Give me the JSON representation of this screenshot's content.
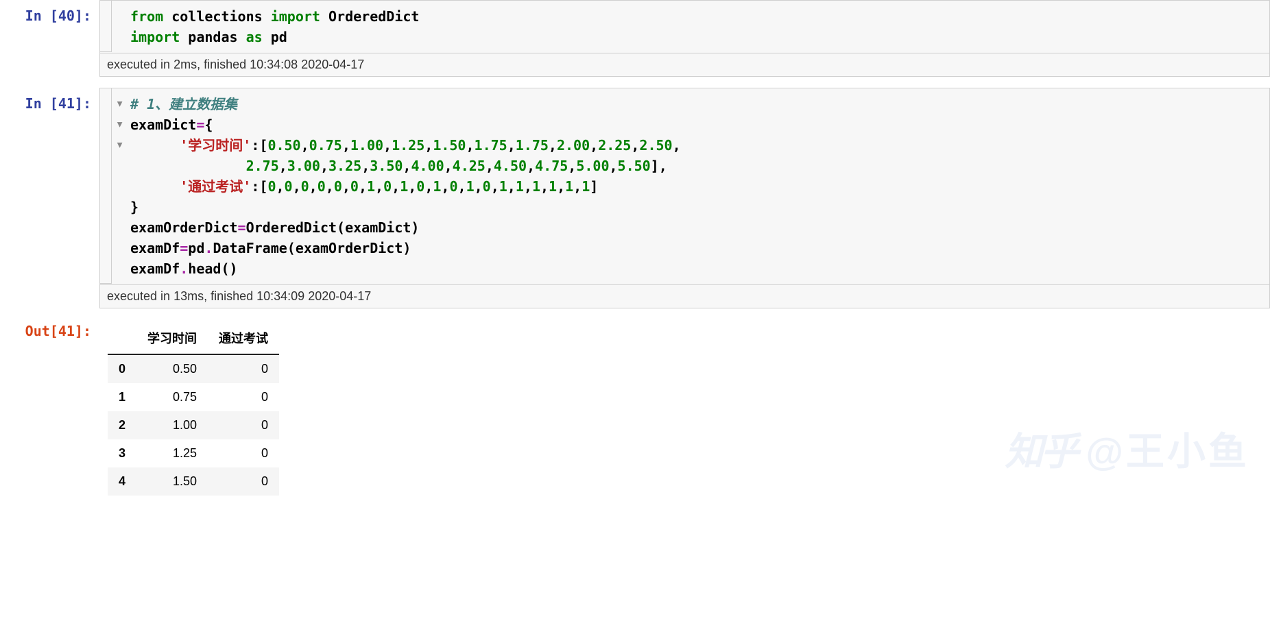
{
  "cells": {
    "cell40": {
      "prompt": "In [40]:",
      "exec_status": "executed in 2ms, finished 10:34:08 2020-04-17",
      "code_tokens": [
        [
          {
            "t": "from",
            "c": "kw"
          },
          {
            "t": " ",
            "c": "plain"
          },
          {
            "t": "collections",
            "c": "plain"
          },
          {
            "t": " ",
            "c": "plain"
          },
          {
            "t": "import",
            "c": "kw"
          },
          {
            "t": " ",
            "c": "plain"
          },
          {
            "t": "OrderedDict",
            "c": "plain"
          }
        ],
        [
          {
            "t": "import",
            "c": "kw"
          },
          {
            "t": " ",
            "c": "plain"
          },
          {
            "t": "pandas",
            "c": "plain"
          },
          {
            "t": " ",
            "c": "plain"
          },
          {
            "t": "as",
            "c": "kw"
          },
          {
            "t": " ",
            "c": "plain"
          },
          {
            "t": "pd",
            "c": "plain"
          }
        ]
      ]
    },
    "cell41": {
      "prompt": "In [41]:",
      "exec_status": "executed in 13ms, finished 10:34:09 2020-04-17",
      "gutter_markers": [
        "▶",
        "▶",
        "▶"
      ],
      "code_tokens": [
        [
          {
            "t": "# 1、建立数据集",
            "c": "cmt"
          }
        ],
        [
          {
            "t": "examDict",
            "c": "plain"
          },
          {
            "t": "=",
            "c": "op"
          },
          {
            "t": "{",
            "c": "plain"
          }
        ],
        [
          {
            "t": "      ",
            "c": "plain"
          },
          {
            "t": "'学习时间'",
            "c": "str"
          },
          {
            "t": ":[",
            "c": "plain"
          },
          {
            "t": "0.50",
            "c": "num"
          },
          {
            "t": ",",
            "c": "plain"
          },
          {
            "t": "0.75",
            "c": "num"
          },
          {
            "t": ",",
            "c": "plain"
          },
          {
            "t": "1.00",
            "c": "num"
          },
          {
            "t": ",",
            "c": "plain"
          },
          {
            "t": "1.25",
            "c": "num"
          },
          {
            "t": ",",
            "c": "plain"
          },
          {
            "t": "1.50",
            "c": "num"
          },
          {
            "t": ",",
            "c": "plain"
          },
          {
            "t": "1.75",
            "c": "num"
          },
          {
            "t": ",",
            "c": "plain"
          },
          {
            "t": "1.75",
            "c": "num"
          },
          {
            "t": ",",
            "c": "plain"
          },
          {
            "t": "2.00",
            "c": "num"
          },
          {
            "t": ",",
            "c": "plain"
          },
          {
            "t": "2.25",
            "c": "num"
          },
          {
            "t": ",",
            "c": "plain"
          },
          {
            "t": "2.50",
            "c": "num"
          },
          {
            "t": ",",
            "c": "plain"
          }
        ],
        [
          {
            "t": "              ",
            "c": "plain"
          },
          {
            "t": "2.75",
            "c": "num"
          },
          {
            "t": ",",
            "c": "plain"
          },
          {
            "t": "3.00",
            "c": "num"
          },
          {
            "t": ",",
            "c": "plain"
          },
          {
            "t": "3.25",
            "c": "num"
          },
          {
            "t": ",",
            "c": "plain"
          },
          {
            "t": "3.50",
            "c": "num"
          },
          {
            "t": ",",
            "c": "plain"
          },
          {
            "t": "4.00",
            "c": "num"
          },
          {
            "t": ",",
            "c": "plain"
          },
          {
            "t": "4.25",
            "c": "num"
          },
          {
            "t": ",",
            "c": "plain"
          },
          {
            "t": "4.50",
            "c": "num"
          },
          {
            "t": ",",
            "c": "plain"
          },
          {
            "t": "4.75",
            "c": "num"
          },
          {
            "t": ",",
            "c": "plain"
          },
          {
            "t": "5.00",
            "c": "num"
          },
          {
            "t": ",",
            "c": "plain"
          },
          {
            "t": "5.50",
            "c": "num"
          },
          {
            "t": "],",
            "c": "plain"
          }
        ],
        [
          {
            "t": "      ",
            "c": "plain"
          },
          {
            "t": "'通过考试'",
            "c": "str"
          },
          {
            "t": ":[",
            "c": "plain"
          },
          {
            "t": "0",
            "c": "num"
          },
          {
            "t": ",",
            "c": "plain"
          },
          {
            "t": "0",
            "c": "num"
          },
          {
            "t": ",",
            "c": "plain"
          },
          {
            "t": "0",
            "c": "num"
          },
          {
            "t": ",",
            "c": "plain"
          },
          {
            "t": "0",
            "c": "num"
          },
          {
            "t": ",",
            "c": "plain"
          },
          {
            "t": "0",
            "c": "num"
          },
          {
            "t": ",",
            "c": "plain"
          },
          {
            "t": "0",
            "c": "num"
          },
          {
            "t": ",",
            "c": "plain"
          },
          {
            "t": "1",
            "c": "num"
          },
          {
            "t": ",",
            "c": "plain"
          },
          {
            "t": "0",
            "c": "num"
          },
          {
            "t": ",",
            "c": "plain"
          },
          {
            "t": "1",
            "c": "num"
          },
          {
            "t": ",",
            "c": "plain"
          },
          {
            "t": "0",
            "c": "num"
          },
          {
            "t": ",",
            "c": "plain"
          },
          {
            "t": "1",
            "c": "num"
          },
          {
            "t": ",",
            "c": "plain"
          },
          {
            "t": "0",
            "c": "num"
          },
          {
            "t": ",",
            "c": "plain"
          },
          {
            "t": "1",
            "c": "num"
          },
          {
            "t": ",",
            "c": "plain"
          },
          {
            "t": "0",
            "c": "num"
          },
          {
            "t": ",",
            "c": "plain"
          },
          {
            "t": "1",
            "c": "num"
          },
          {
            "t": ",",
            "c": "plain"
          },
          {
            "t": "1",
            "c": "num"
          },
          {
            "t": ",",
            "c": "plain"
          },
          {
            "t": "1",
            "c": "num"
          },
          {
            "t": ",",
            "c": "plain"
          },
          {
            "t": "1",
            "c": "num"
          },
          {
            "t": ",",
            "c": "plain"
          },
          {
            "t": "1",
            "c": "num"
          },
          {
            "t": ",",
            "c": "plain"
          },
          {
            "t": "1",
            "c": "num"
          },
          {
            "t": "]",
            "c": "plain"
          }
        ],
        [
          {
            "t": "}",
            "c": "plain"
          }
        ],
        [
          {
            "t": "examOrderDict",
            "c": "plain"
          },
          {
            "t": "=",
            "c": "op"
          },
          {
            "t": "OrderedDict(examDict)",
            "c": "plain"
          }
        ],
        [
          {
            "t": "examDf",
            "c": "plain"
          },
          {
            "t": "=",
            "c": "op"
          },
          {
            "t": "pd",
            "c": "plain"
          },
          {
            "t": ".",
            "c": "op"
          },
          {
            "t": "DataFrame(examOrderDict)",
            "c": "plain"
          }
        ],
        [
          {
            "t": "examDf",
            "c": "plain"
          },
          {
            "t": ".",
            "c": "op"
          },
          {
            "t": "head()",
            "c": "plain"
          }
        ]
      ]
    },
    "out41": {
      "prompt": "Out[41]:",
      "table": {
        "columns": [
          "学习时间",
          "通过考试"
        ],
        "index": [
          "0",
          "1",
          "2",
          "3",
          "4"
        ],
        "rows": [
          [
            "0.50",
            "0"
          ],
          [
            "0.75",
            "0"
          ],
          [
            "1.00",
            "0"
          ],
          [
            "1.25",
            "0"
          ],
          [
            "1.50",
            "0"
          ]
        ]
      }
    }
  },
  "watermark": {
    "logo": "知乎",
    "text": "@王小鱼"
  }
}
